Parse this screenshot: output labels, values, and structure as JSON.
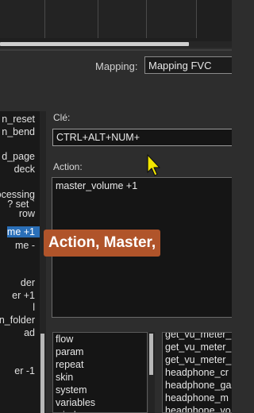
{
  "mapping": {
    "label": "Mapping:",
    "value": "Mapping FVC"
  },
  "left_list": {
    "items": [
      "n_reset",
      "n_bend",
      "d_page",
      "deck",
      "ocessing",
      "? set `",
      "row",
      "me +1",
      "me -",
      "der",
      "er +1",
      "l",
      "n_folder",
      "ad",
      "er -1"
    ],
    "selected_index": 7
  },
  "key": {
    "label": "Clé:",
    "value": "CTRL+ALT+NUM+"
  },
  "action": {
    "label": "Action:",
    "value": "master_volume +1"
  },
  "caption": "Action, Master,",
  "categories": [
    "flow",
    "param",
    "repeat",
    "skin",
    "system",
    "variables",
    "window"
  ],
  "commands": [
    "get_vu_meter_",
    "get_vu_meter_",
    "get_vu_meter_",
    "headphone_cr",
    "headphone_ga",
    "headphone_m",
    "headphone_vo"
  ]
}
